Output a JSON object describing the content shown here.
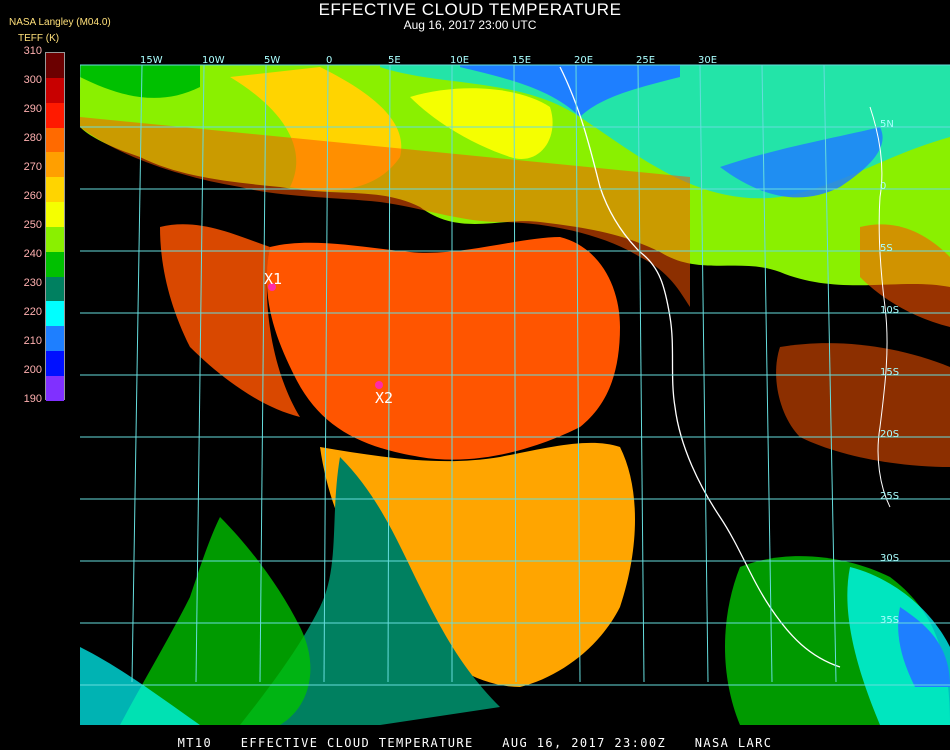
{
  "header": {
    "title": "EFFECTIVE CLOUD TEMPERATURE",
    "subtitle": "Aug 16, 2017 23:00 UTC",
    "source": "NASA Langley (M04.0)",
    "units": "TEFF (K)"
  },
  "legend": {
    "labels": [
      "310",
      "300",
      "290",
      "280",
      "270",
      "260",
      "250",
      "240",
      "230",
      "220",
      "210",
      "200",
      "190"
    ],
    "colors": [
      "#6b0000",
      "#c80000",
      "#ff1a00",
      "#ff6a00",
      "#ff9f00",
      "#ffd400",
      "#f5ff00",
      "#8af000",
      "#00c000",
      "#008060",
      "#00ffff",
      "#1e7fff",
      "#0010ff",
      "#8030ff"
    ]
  },
  "map": {
    "markers": [
      {
        "label": "X1",
        "color": "#ff2aa8"
      },
      {
        "label": "X2",
        "color": "#ff2aa8"
      }
    ],
    "lat_labels": [
      "5N",
      "0",
      "5S",
      "10S",
      "15S",
      "20S",
      "25S",
      "30S",
      "35S"
    ],
    "lon_labels": [
      "15W",
      "10W",
      "5W",
      "0",
      "5E",
      "10E",
      "15E",
      "20E",
      "25E",
      "30E"
    ],
    "colors": {
      "ocean_stratus": "#ff5500",
      "warm_low": "#ff9f00",
      "clear": "#000000",
      "grid": "#66dddd",
      "coast": "#ffffff"
    }
  },
  "footer": {
    "product": "MT10",
    "name": "EFFECTIVE CLOUD TEMPERATURE",
    "time": "AUG 16, 2017 23:00Z",
    "org": "NASA LARC"
  }
}
